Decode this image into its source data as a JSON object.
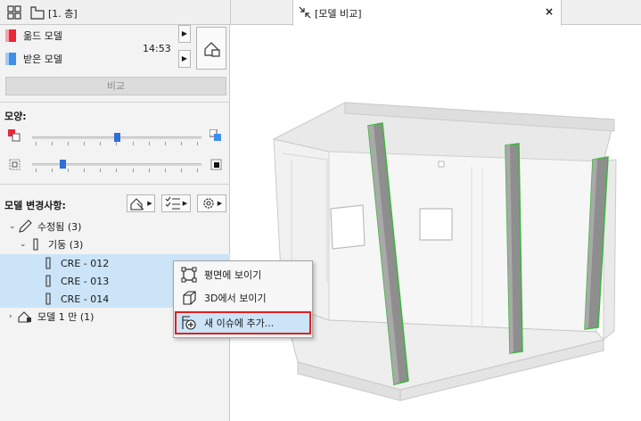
{
  "topbar": {
    "floor_tab_label": "[1. 층]",
    "compare_tab_label": "[모델 비교]",
    "close_glyph": "×"
  },
  "models": {
    "old_label": "옮드 모델",
    "received_label": "받은 모델",
    "time": "14:53",
    "old_color": "#e8283a",
    "received_color": "#3f8fe8"
  },
  "compare_button": "비교",
  "shape_section": {
    "title": "모양:",
    "slider1_level": 0.5,
    "slider2_level": 0.18
  },
  "changes_section": {
    "title": "모델 변경사항:"
  },
  "tree": {
    "modified": {
      "label": "수정됨",
      "count": "(3)"
    },
    "columns": {
      "label": "기둥",
      "count": "(3)"
    },
    "items": [
      "CRE - 012",
      "CRE - 013",
      "CRE - 014"
    ],
    "only_in_model1": {
      "label": "모델 1 만",
      "count": "(1)"
    }
  },
  "context_menu": {
    "items": [
      "평면에 보이기",
      "3D에서 보이기",
      "새 이슈에 추가..."
    ],
    "highlight_color": "#e02020"
  }
}
